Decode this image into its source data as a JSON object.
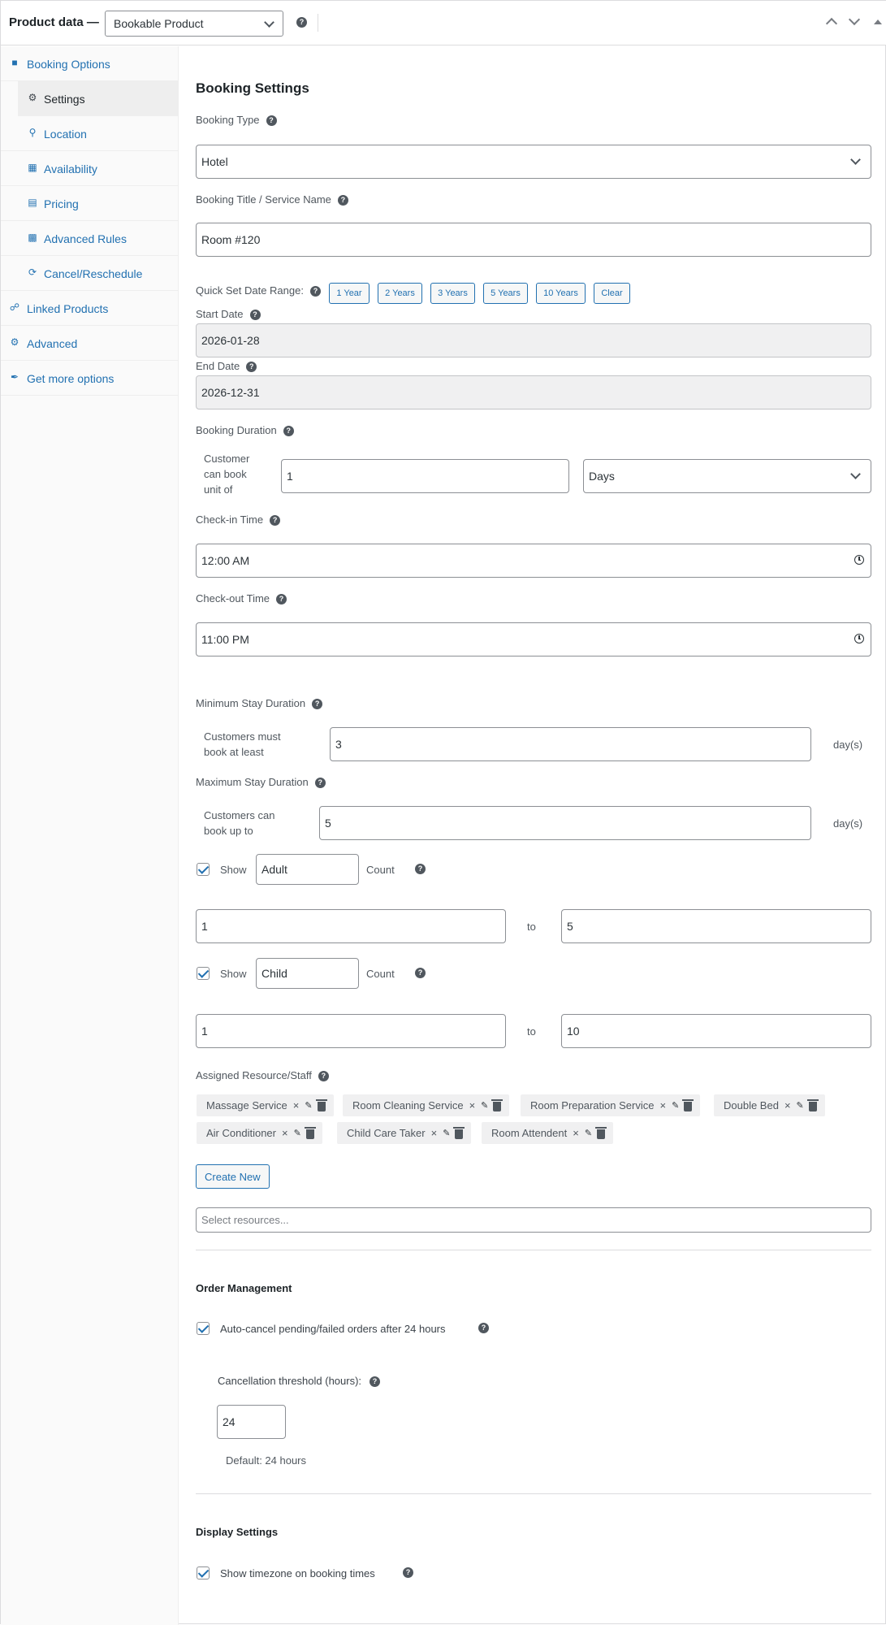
{
  "header": {
    "title": "Product data —",
    "product_type": "Bookable Product"
  },
  "sidebar": {
    "items": [
      {
        "label": "Booking Options",
        "icon": "book-icon"
      },
      {
        "label": "Settings",
        "icon": "gear-icon"
      },
      {
        "label": "Location",
        "icon": "pin-icon"
      },
      {
        "label": "Availability",
        "icon": "calendar-icon"
      },
      {
        "label": "Pricing",
        "icon": "list-icon"
      },
      {
        "label": "Advanced Rules",
        "icon": "grid-icon"
      },
      {
        "label": "Cancel/Reschedule",
        "icon": "refresh-icon"
      },
      {
        "label": "Linked Products",
        "icon": "link-icon"
      },
      {
        "label": "Advanced",
        "icon": "gear-icon"
      },
      {
        "label": "Get more options",
        "icon": "plugin-icon"
      }
    ]
  },
  "booking": {
    "heading": "Booking Settings",
    "type_label": "Booking Type",
    "type_value": "Hotel",
    "title_label": "Booking Title / Service Name",
    "title_value": "Room #120",
    "quick_set_label": "Quick Set Date Range:",
    "quick_buttons": [
      "1 Year",
      "2 Years",
      "3 Years",
      "5 Years",
      "10 Years",
      "Clear"
    ],
    "start_label": "Start Date",
    "start_value": "2026-01-28",
    "end_label": "End Date",
    "end_value": "2026-12-31",
    "duration_label": "Booking Duration",
    "duration_prefix": "Customer can book unit of",
    "duration_value": "1",
    "duration_unit": "Days",
    "checkin_label": "Check-in Time",
    "checkin_value": "12:00 AM",
    "checkout_label": "Check-out Time",
    "checkout_value": "11:00 PM",
    "min_label": "Minimum Stay Duration",
    "min_prefix": "Customers must book at least",
    "min_value": "3",
    "min_unit": "day(s)",
    "max_label": "Maximum Stay Duration",
    "max_prefix": "Customers can book up to",
    "max_value": "5",
    "max_unit": "day(s)",
    "show_text": "Show",
    "count_text": "Count",
    "adult_label_value": "Adult",
    "adult_min": "1",
    "adult_max": "5",
    "child_label_value": "Child",
    "child_min": "1",
    "child_max": "10",
    "to_text": "to",
    "resources_label": "Assigned Resource/Staff",
    "resources": [
      "Massage Service",
      "Room Cleaning Service",
      "Room Preparation Service",
      "Double Bed",
      "Air Conditioner",
      "Child Care Taker",
      "Room Attendent"
    ],
    "remove_glyph": "×",
    "create_new": "Create New",
    "resources_placeholder": "Select resources..."
  },
  "order": {
    "heading": "Order Management",
    "auto_cancel_label": "Auto-cancel pending/failed orders after 24 hours",
    "threshold_label": "Cancellation threshold (hours):",
    "threshold_value": "24",
    "default_text": "Default: 24 hours"
  },
  "display": {
    "heading": "Display Settings",
    "timezone_label": "Show timezone on booking times"
  },
  "colors": {
    "link": "#2271b1",
    "border": "#8c8f94",
    "readonly_bg": "#f0f0f1",
    "sidebar_bg": "#fafafa"
  }
}
